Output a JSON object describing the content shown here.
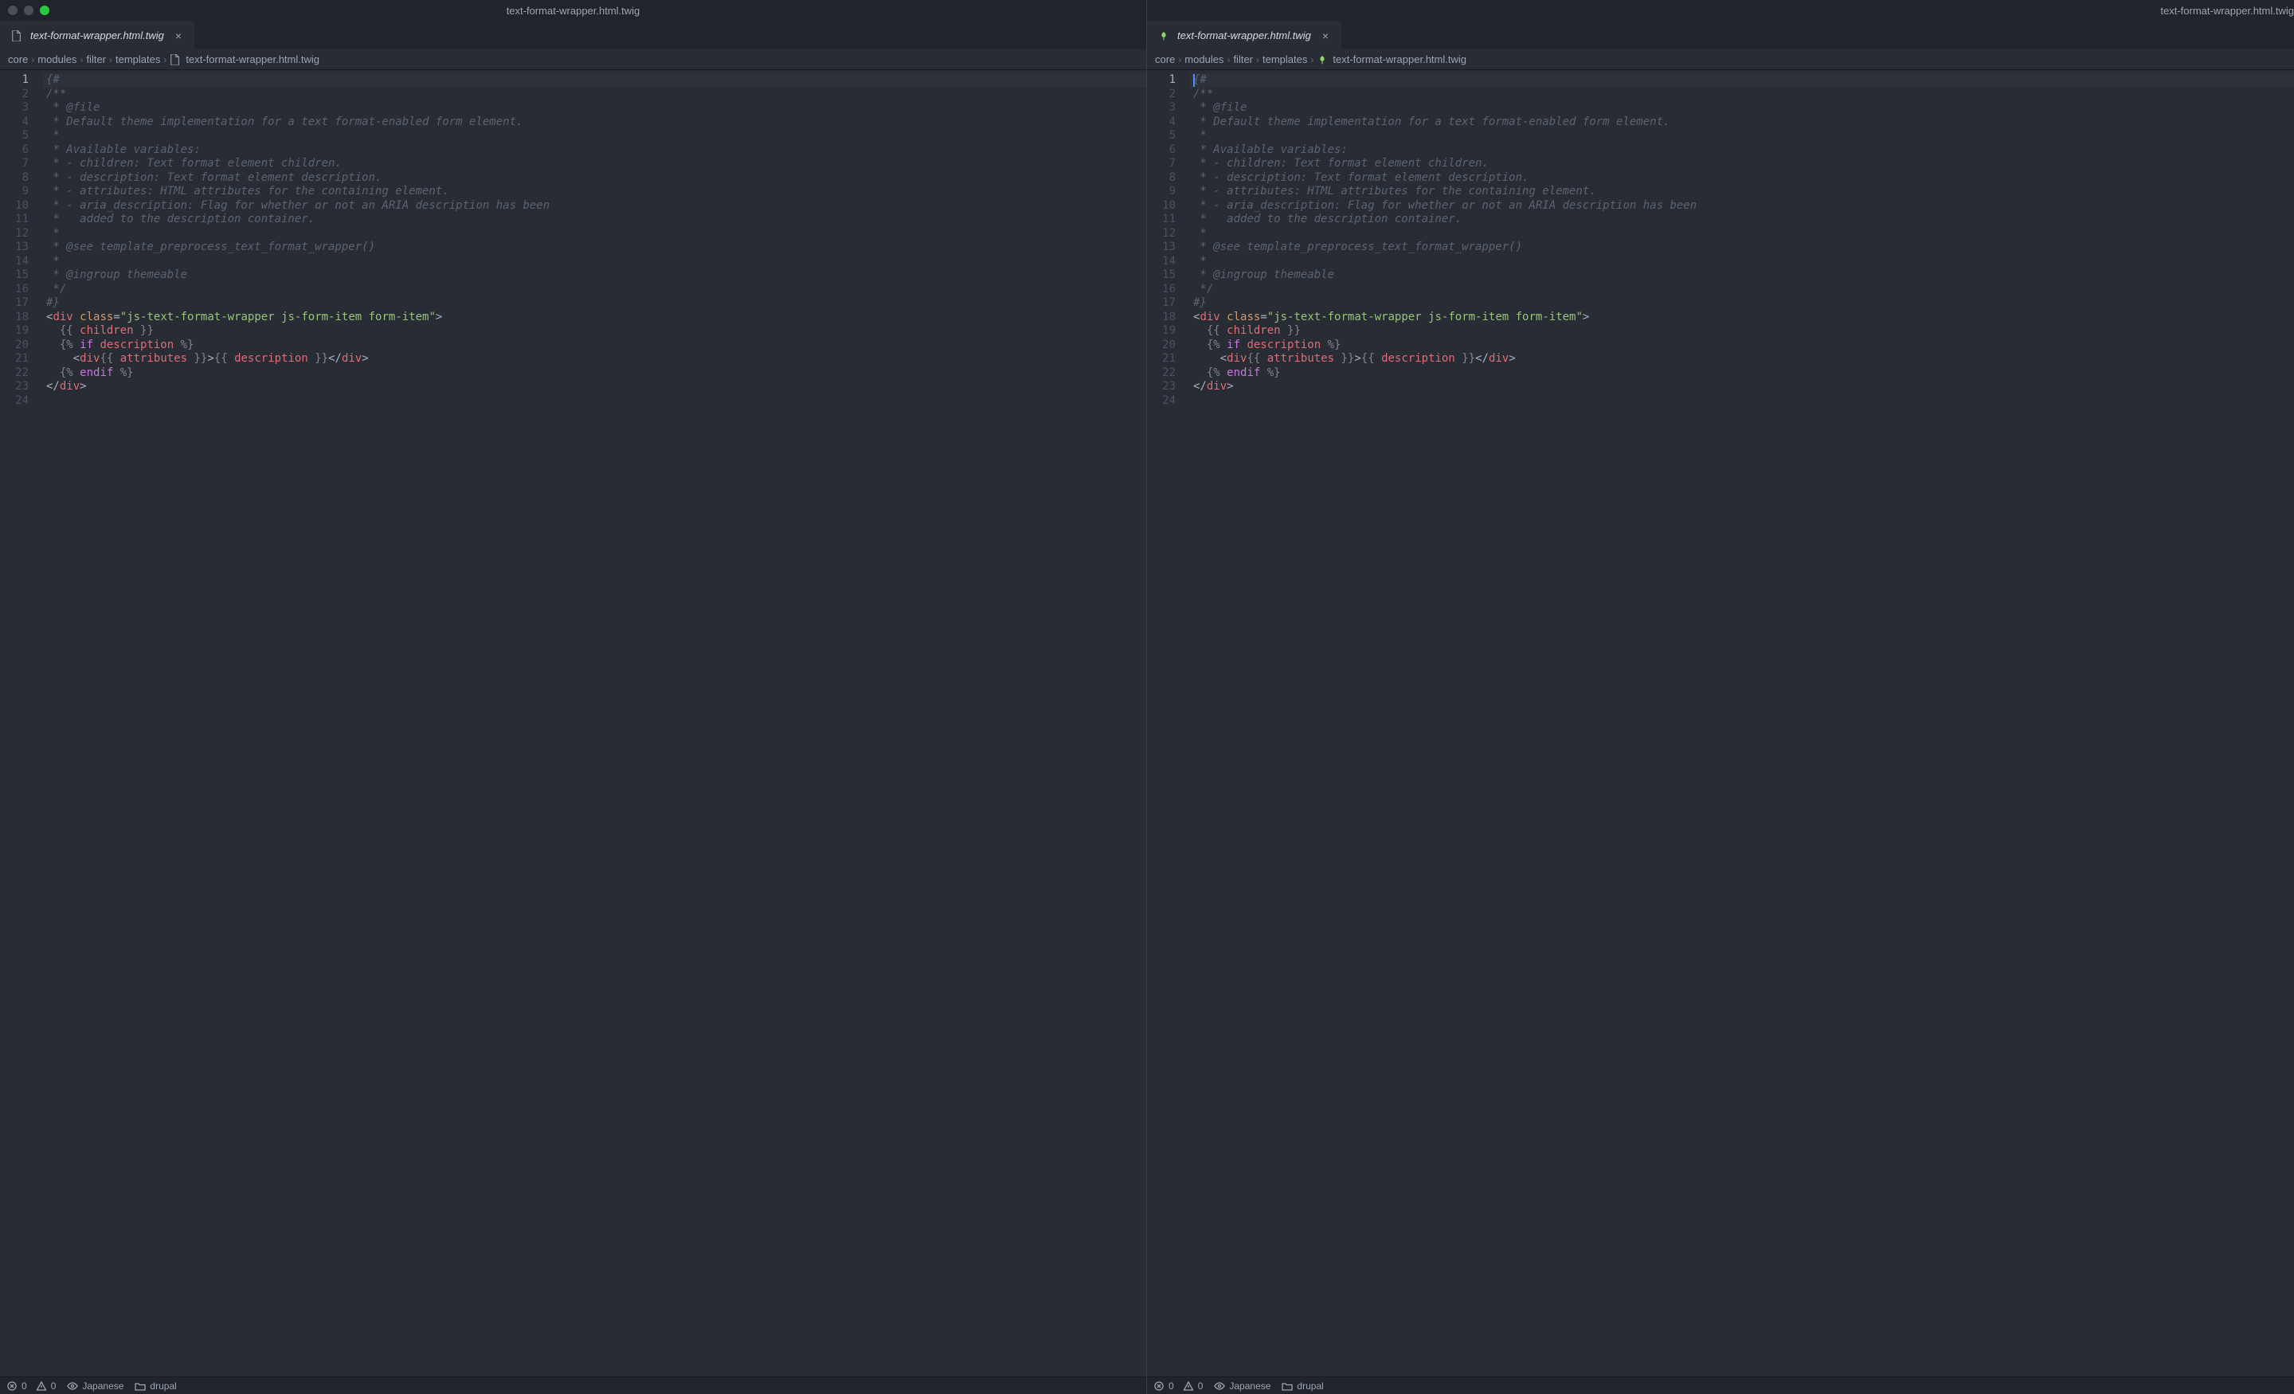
{
  "title": "text-format-wrapper.html.twig",
  "tab": {
    "label": "text-format-wrapper.html.twig",
    "close": "×"
  },
  "breadcrumb": {
    "items": [
      "core",
      "modules",
      "filter",
      "templates",
      "text-format-wrapper.html.twig"
    ],
    "sep": "›"
  },
  "code": {
    "lines": [
      {
        "n": 1,
        "type": "cm",
        "text": "{#",
        "hl": true
      },
      {
        "n": 2,
        "type": "cm",
        "text": "/**"
      },
      {
        "n": 3,
        "type": "cm",
        "text": " * @file"
      },
      {
        "n": 4,
        "type": "cm",
        "text": " * Default theme implementation for a text format-enabled form element."
      },
      {
        "n": 5,
        "type": "cm",
        "text": " *"
      },
      {
        "n": 6,
        "type": "cm",
        "text": " * Available variables:"
      },
      {
        "n": 7,
        "type": "cm",
        "text": " * - children: Text format element children."
      },
      {
        "n": 8,
        "type": "cm",
        "text": " * - description: Text format element description."
      },
      {
        "n": 9,
        "type": "cm",
        "text": " * - attributes: HTML attributes for the containing element."
      },
      {
        "n": 10,
        "type": "cm",
        "text": " * - aria_description: Flag for whether or not an ARIA description has been"
      },
      {
        "n": 11,
        "type": "cm",
        "text": " *   added to the description container."
      },
      {
        "n": 12,
        "type": "cm",
        "text": " *"
      },
      {
        "n": 13,
        "type": "cm",
        "text": " * @see template_preprocess_text_format_wrapper()"
      },
      {
        "n": 14,
        "type": "cm",
        "text": " *"
      },
      {
        "n": 15,
        "type": "cm",
        "text": " * @ingroup themeable"
      },
      {
        "n": 16,
        "type": "cm",
        "text": " */"
      },
      {
        "n": 17,
        "type": "cm",
        "text": "#}"
      },
      {
        "n": 18,
        "type": "html_open"
      },
      {
        "n": 19,
        "type": "twig_children"
      },
      {
        "n": 20,
        "type": "twig_if"
      },
      {
        "n": 21,
        "type": "twig_desc"
      },
      {
        "n": 22,
        "type": "twig_endif"
      },
      {
        "n": 23,
        "type": "html_close"
      },
      {
        "n": 24,
        "type": "blank",
        "text": ""
      }
    ]
  },
  "html_open": {
    "lt": "<",
    "tag": "div",
    "sp": " ",
    "attr": "class",
    "eq": "=",
    "q": "\"",
    "val": "js-text-format-wrapper js-form-item form-item",
    "gt": ">"
  },
  "twig_children": {
    "indent": "  ",
    "open": "{{ ",
    "var": "children",
    "close": " }}"
  },
  "twig_if": {
    "indent": "  ",
    "open": "{% ",
    "kw": "if",
    "sp": " ",
    "var": "description",
    "close": " %}"
  },
  "twig_desc": {
    "indent": "    ",
    "lt": "<",
    "tag": "div",
    "oo": "{{ ",
    "v1": "attributes",
    "oc": " }}",
    "gt": ">",
    "oo2": "{{ ",
    "v2": "description",
    "oc2": " }}",
    "lt2": "</",
    "tag2": "div",
    "gt2": ">"
  },
  "twig_endif": {
    "indent": "  ",
    "open": "{% ",
    "kw": "endif",
    "close": " %}"
  },
  "html_close": {
    "lt": "</",
    "tag": "div",
    "gt": ">"
  },
  "status": {
    "errors": "0",
    "warnings": "0",
    "language": "Japanese",
    "folder": "drupal"
  },
  "icons": {
    "chevron": "›"
  }
}
